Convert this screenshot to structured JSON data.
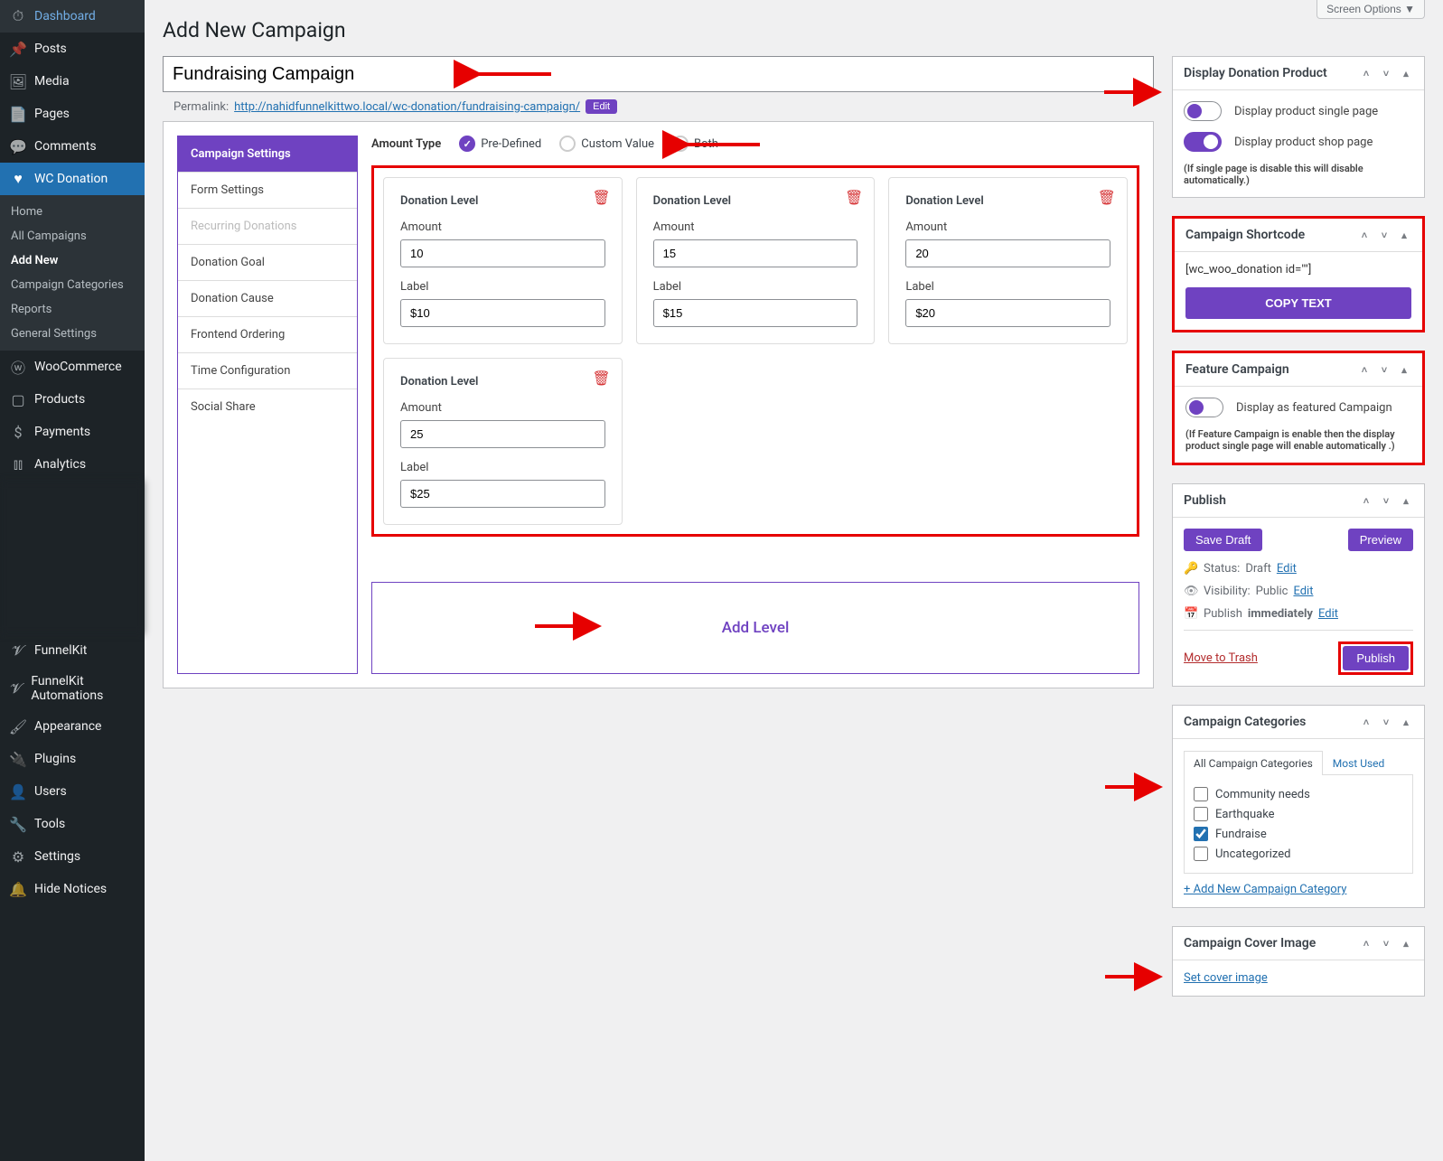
{
  "screen_options": "Screen Options ▼",
  "page_title": "Add New Campaign",
  "title_value": "Fundraising Campaign",
  "permalink": {
    "label": "Permalink:",
    "url": "http://nahidfunnelkittwo.local/wc-donation/fundraising-campaign/",
    "edit": "Edit"
  },
  "sidebar_menu": {
    "dashboard": "Dashboard",
    "posts": "Posts",
    "media": "Media",
    "pages": "Pages",
    "comments": "Comments",
    "wc_donation": "WC Donation",
    "woocommerce": "WooCommerce",
    "products": "Products",
    "payments": "Payments",
    "analytics": "Analytics",
    "funnelkit": "FunnelKit",
    "funnelkit_auto": "FunnelKit Automations",
    "appearance": "Appearance",
    "plugins": "Plugins",
    "users": "Users",
    "tools": "Tools",
    "settings": "Settings",
    "hide_notices": "Hide Notices"
  },
  "submenu": {
    "home": "Home",
    "all_campaigns": "All Campaigns",
    "add_new": "Add New",
    "campaign_categories": "Campaign Categories",
    "reports": "Reports",
    "general_settings": "General Settings"
  },
  "campaign_tabs": {
    "settings": "Campaign Settings",
    "form": "Form Settings",
    "recurring": "Recurring Donations",
    "goal": "Donation Goal",
    "cause": "Donation Cause",
    "ordering": "Frontend Ordering",
    "time": "Time Configuration",
    "social": "Social Share"
  },
  "amount_type": {
    "label": "Amount Type",
    "predefined": "Pre-Defined",
    "custom": "Custom Value",
    "both": "Both"
  },
  "level_labels": {
    "title": "Donation Level",
    "amount": "Amount",
    "label": "Label"
  },
  "levels": [
    {
      "amount": "10",
      "label": "$10"
    },
    {
      "amount": "15",
      "label": "$15"
    },
    {
      "amount": "20",
      "label": "$20"
    },
    {
      "amount": "25",
      "label": "$25"
    }
  ],
  "add_level": "Add Level",
  "panels": {
    "display_product": {
      "title": "Display Donation Product",
      "single": "Display product single page",
      "shop": "Display product shop page",
      "note": "(If single page is disable this will disable automatically.)"
    },
    "shortcode": {
      "title": "Campaign Shortcode",
      "text": "[wc_woo_donation id=\"\"]",
      "copy": "COPY TEXT"
    },
    "feature": {
      "title": "Feature Campaign",
      "label": "Display as featured Campaign",
      "note": "(If Feature Campaign is enable then the display product single page will enable automatically .)"
    },
    "publish": {
      "title": "Publish",
      "save_draft": "Save Draft",
      "preview": "Preview",
      "status_label": "Status:",
      "status_value": "Draft",
      "visibility_label": "Visibility:",
      "visibility_value": "Public",
      "publish_label": "Publish",
      "publish_value": "immediately",
      "edit": "Edit",
      "trash": "Move to Trash",
      "publish_btn": "Publish"
    },
    "categories": {
      "title": "Campaign Categories",
      "tab_all": "All Campaign Categories",
      "tab_most": "Most Used",
      "items": [
        {
          "label": "Community needs",
          "checked": false
        },
        {
          "label": "Earthquake",
          "checked": false
        },
        {
          "label": "Fundraise",
          "checked": true
        },
        {
          "label": "Uncategorized",
          "checked": false
        }
      ],
      "add_new": "+ Add New Campaign Category"
    },
    "cover": {
      "title": "Campaign Cover Image",
      "link": "Set cover image"
    }
  }
}
